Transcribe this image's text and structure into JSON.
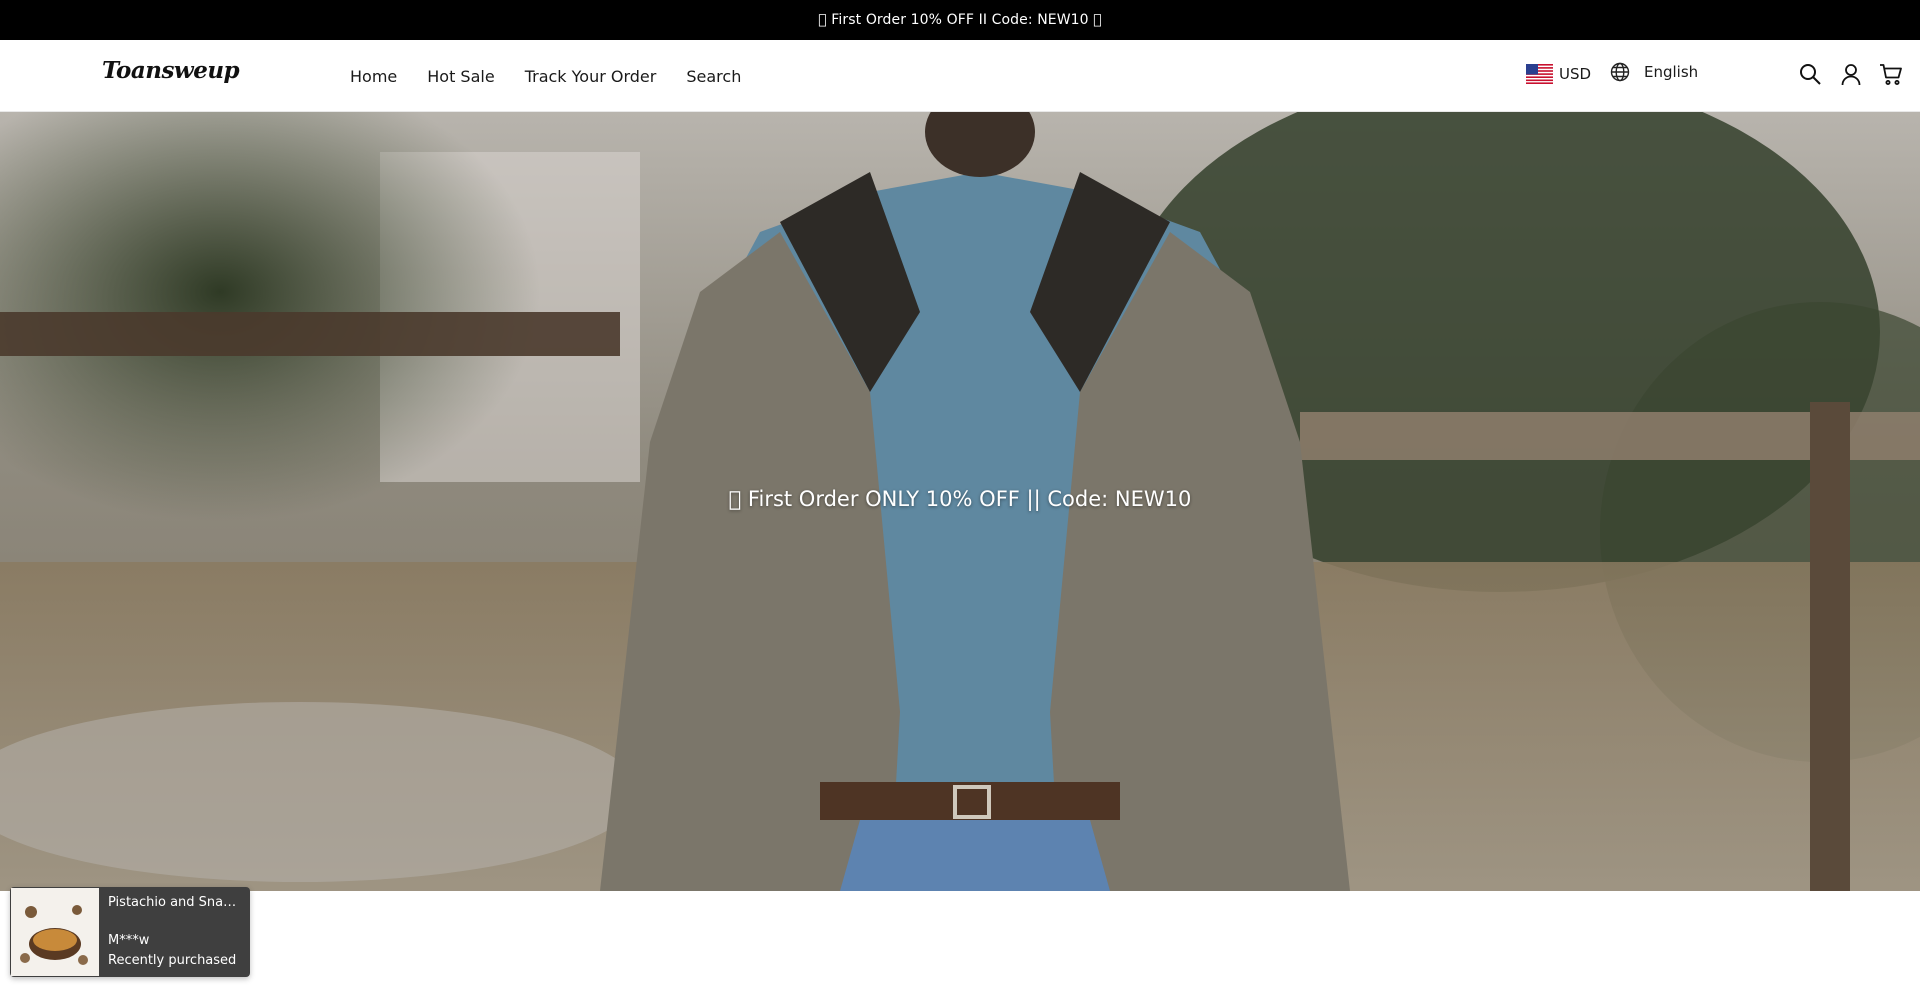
{
  "announcement": {
    "text": "\u0000 First Order 10% OFF II Code: NEW10 \u0000"
  },
  "header": {
    "logo": "Toansweup",
    "nav": [
      "Home",
      "Hot Sale",
      "Track Your Order",
      "Search"
    ],
    "currency": "USD",
    "language": "English"
  },
  "hero": {
    "text": "\u0000 First Order ONLY 10% OFF || Code: NEW10"
  },
  "popup": {
    "product": "Pistachio and Snac...",
    "user": "M***w",
    "status": "Recently purchased"
  },
  "icons": [
    "us-flag-icon",
    "globe-icon",
    "search-icon",
    "account-icon",
    "cart-icon"
  ],
  "colors": {
    "announcement_bg": "#000000",
    "popup_bg": "#3f3f3f"
  }
}
